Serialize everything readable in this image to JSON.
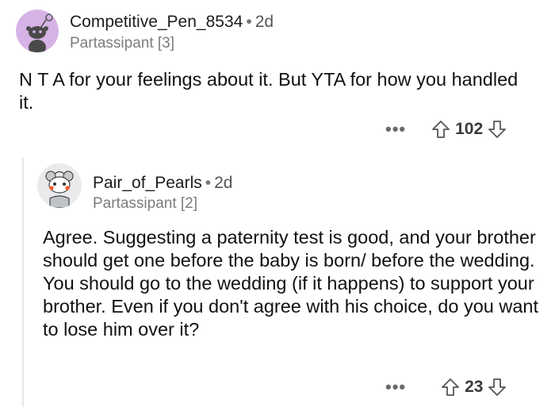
{
  "comment1": {
    "username": "Competitive_Pen_8534",
    "separator": "•",
    "age": "2d",
    "flair": "Partassipant [3]",
    "body": "N T A for your feelings about it.  But YTA for how you handled it.",
    "more": "•••",
    "score": "102"
  },
  "comment2": {
    "username": "Pair_of_Pearls",
    "separator": "•",
    "age": "2d",
    "flair": "Partassipant [2]",
    "body": "Agree. Suggesting a paternity test is good, and your brother should get one before the baby is born/ before the wedding. You should go to the wedding (if it happens) to support your brother. Even if you don't agree with his choice, do you want to lose him over it?",
    "more": "•••",
    "score": "23"
  },
  "colors": {
    "avatar1_bg": "#d6b3e6",
    "avatar2_bg": "#e9eaec",
    "text": "#111111",
    "muted": "#7c7c7c"
  },
  "icons": [
    "upvote-arrow-icon",
    "downvote-arrow-icon",
    "more-options-icon",
    "snoo-avatar-icon"
  ]
}
